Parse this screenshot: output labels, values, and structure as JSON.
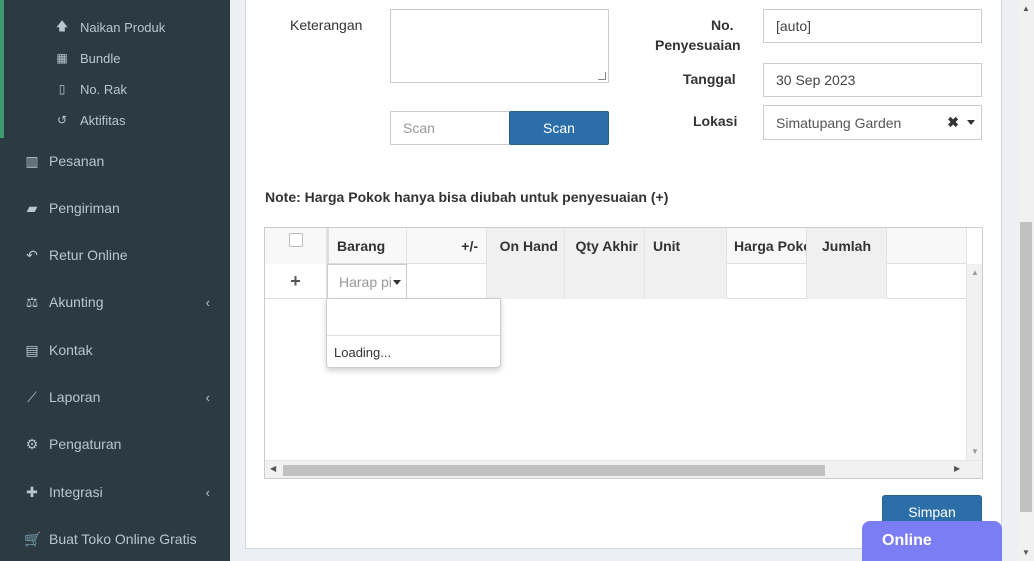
{
  "sidebar": {
    "submenu": [
      {
        "label": "Naikan Produk",
        "icon": "arrow-up-icon"
      },
      {
        "label": "Bundle",
        "icon": "grid-icon"
      },
      {
        "label": "No. Rak",
        "icon": "bookmark-icon"
      },
      {
        "label": "Aktifitas",
        "icon": "history-icon"
      }
    ],
    "items": [
      {
        "label": "Pesanan",
        "icon": "basket-icon",
        "has_children": false
      },
      {
        "label": "Pengiriman",
        "icon": "truck-icon",
        "has_children": false
      },
      {
        "label": "Retur Online",
        "icon": "reply-icon",
        "has_children": false
      },
      {
        "label": "Akunting",
        "icon": "balance-scale-icon",
        "has_children": true
      },
      {
        "label": "Kontak",
        "icon": "id-card-icon",
        "has_children": false
      },
      {
        "label": "Laporan",
        "icon": "line-chart-icon",
        "has_children": true
      },
      {
        "label": "Pengaturan",
        "icon": "cogs-icon",
        "has_children": false
      },
      {
        "label": "Integrasi",
        "icon": "puzzle-icon",
        "has_children": true
      },
      {
        "label": "Buat Toko Online Gratis",
        "icon": "cart-icon",
        "has_children": false
      }
    ]
  },
  "form": {
    "keterangan_label": "Keterangan",
    "no_penyesuaian_label_1": "No.",
    "no_penyesuaian_label_2": "Penyesuaian",
    "no_penyesuaian_value": "[auto]",
    "tanggal_label": "Tanggal",
    "tanggal_value": "30 Sep 2023",
    "lokasi_label": "Lokasi",
    "lokasi_value": "Simatupang Garden",
    "scan_placeholder": "Scan",
    "scan_button": "Scan",
    "note": "Note: Harga Pokok hanya bisa diubah untuk penyesuaian (+)"
  },
  "grid": {
    "columns": [
      "Barang",
      "+/-",
      "On Hand",
      "Qty Akhir",
      "Unit",
      "Harga Pokok",
      "Jumlah"
    ],
    "add_row_symbol": "+",
    "barang_placeholder": "Harap pilih",
    "dropdown_status": "Loading..."
  },
  "actions": {
    "save_button": "Simpan"
  },
  "chat": {
    "status": "Online"
  },
  "colors": {
    "sidebar_bg": "#2c3b41",
    "accent_green": "#3c9b6c",
    "primary_blue": "#2c6fa8",
    "chat_purple": "#7b7df5"
  }
}
